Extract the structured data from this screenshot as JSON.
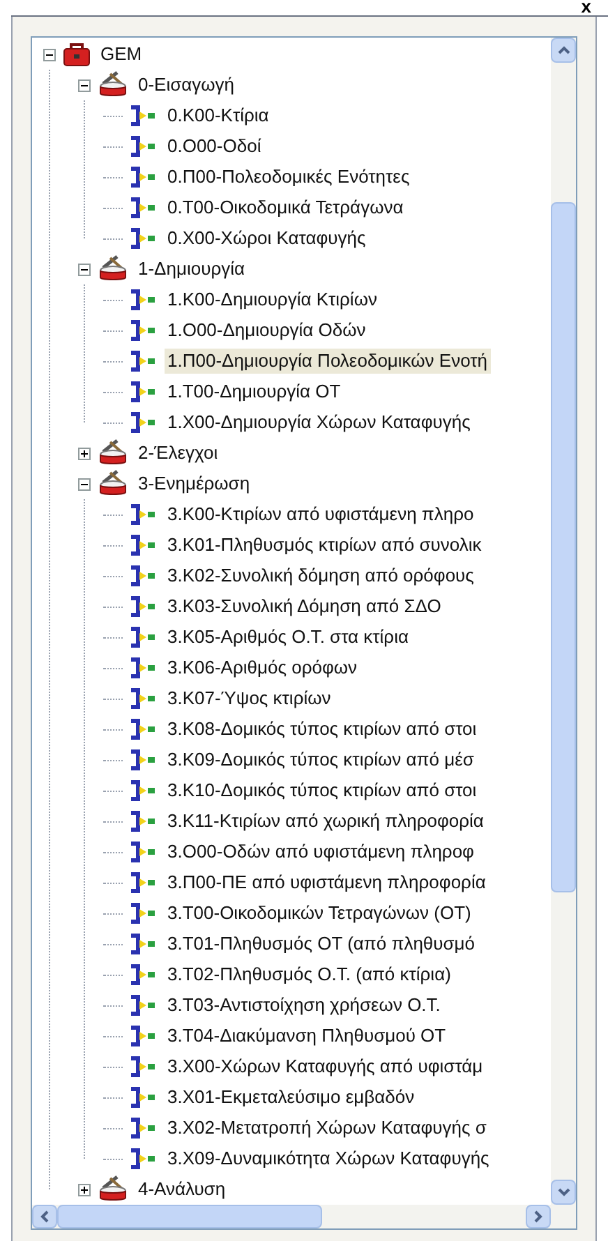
{
  "close_button": "x",
  "tree": {
    "label": "GEM",
    "kind": "root",
    "expanded": true,
    "selected": false,
    "children": [
      {
        "label": "0-Εισαγωγή",
        "kind": "group",
        "expanded": true,
        "selected": false,
        "children": [
          {
            "label": "0.K00-Κτίρια",
            "kind": "leaf",
            "selected": false
          },
          {
            "label": "0.O00-Οδοί",
            "kind": "leaf",
            "selected": false
          },
          {
            "label": "0.Π00-Πολεοδομικές Ενότητες",
            "kind": "leaf",
            "selected": false
          },
          {
            "label": "0.T00-Οικοδομικά Τετράγωνα",
            "kind": "leaf",
            "selected": false
          },
          {
            "label": "0.X00-Χώροι Καταφυγής",
            "kind": "leaf",
            "selected": false
          }
        ]
      },
      {
        "label": "1-Δημιουργία",
        "kind": "group",
        "expanded": true,
        "selected": false,
        "children": [
          {
            "label": "1.K00-Δημιουργία Κτιρίων",
            "kind": "leaf",
            "selected": false
          },
          {
            "label": "1.O00-Δημιουργία Οδών",
            "kind": "leaf",
            "selected": false
          },
          {
            "label": "1.Π00-Δημιουργία Πολεοδομικών Ενοτή",
            "kind": "leaf",
            "selected": true
          },
          {
            "label": "1.T00-Δημιουργία ΟΤ",
            "kind": "leaf",
            "selected": false
          },
          {
            "label": "1.X00-Δημιουργία Χώρων Καταφυγής",
            "kind": "leaf",
            "selected": false
          }
        ]
      },
      {
        "label": "2-Έλεγχοι",
        "kind": "group",
        "expanded": false,
        "selected": false
      },
      {
        "label": "3-Ενημέρωση",
        "kind": "group",
        "expanded": true,
        "selected": false,
        "children": [
          {
            "label": "3.K00-Κτιρίων από υφιστάμενη πληρο",
            "kind": "leaf",
            "selected": false
          },
          {
            "label": "3.K01-Πληθυσμός κτιρίων από συνολικ",
            "kind": "leaf",
            "selected": false
          },
          {
            "label": "3.K02-Συνολική δόμηση από ορόφους",
            "kind": "leaf",
            "selected": false
          },
          {
            "label": "3.K03-Συνολική Δόμηση από ΣΔΟ",
            "kind": "leaf",
            "selected": false
          },
          {
            "label": "3.K05-Αριθμός Ο.Τ. στα κτίρια",
            "kind": "leaf",
            "selected": false
          },
          {
            "label": "3.K06-Αριθμός ορόφων",
            "kind": "leaf",
            "selected": false
          },
          {
            "label": "3.K07-Ύψος κτιρίων",
            "kind": "leaf",
            "selected": false
          },
          {
            "label": "3.K08-Δομικός τύπος κτιρίων από στοι",
            "kind": "leaf",
            "selected": false
          },
          {
            "label": "3.K09-Δομικός τύπος κτιρίων από μέσ",
            "kind": "leaf",
            "selected": false
          },
          {
            "label": "3.K10-Δομικός τύπος κτιρίων από στοι",
            "kind": "leaf",
            "selected": false
          },
          {
            "label": "3.K11-Κτιρίων από χωρική πληροφορία",
            "kind": "leaf",
            "selected": false
          },
          {
            "label": "3.O00-Οδών από υφιστάμενη πληροφ",
            "kind": "leaf",
            "selected": false
          },
          {
            "label": "3.Π00-ΠΕ από υφιστάμενη πληροφορία",
            "kind": "leaf",
            "selected": false
          },
          {
            "label": "3.T00-Οικοδομικών Τετραγώνων (ΟΤ)",
            "kind": "leaf",
            "selected": false
          },
          {
            "label": "3.T01-Πληθυσμός ΟΤ (από πληθυσμό",
            "kind": "leaf",
            "selected": false
          },
          {
            "label": "3.T02-Πληθυσμός Ο.Τ. (από κτίρια)",
            "kind": "leaf",
            "selected": false
          },
          {
            "label": "3.T03-Αντιστοίχηση χρήσεων Ο.Τ.",
            "kind": "leaf",
            "selected": false
          },
          {
            "label": "3.T04-Διακύμανση Πληθυσμού ΟΤ",
            "kind": "leaf",
            "selected": false
          },
          {
            "label": "3.X00-Χώρων Καταφυγής από υφιστάμ",
            "kind": "leaf",
            "selected": false
          },
          {
            "label": "3.X01-Εκμεταλεύσιμο εμβαδόν",
            "kind": "leaf",
            "selected": false
          },
          {
            "label": "3.X02-Μετατροπή Χώρων Καταφυγής σ",
            "kind": "leaf",
            "selected": false
          },
          {
            "label": "3.X09-Δυναμικότητα Χώρων Καταφυγής",
            "kind": "leaf",
            "selected": false
          }
        ]
      },
      {
        "label": "4-Ανάλυση",
        "kind": "group",
        "expanded": false,
        "selected": false
      }
    ]
  }
}
